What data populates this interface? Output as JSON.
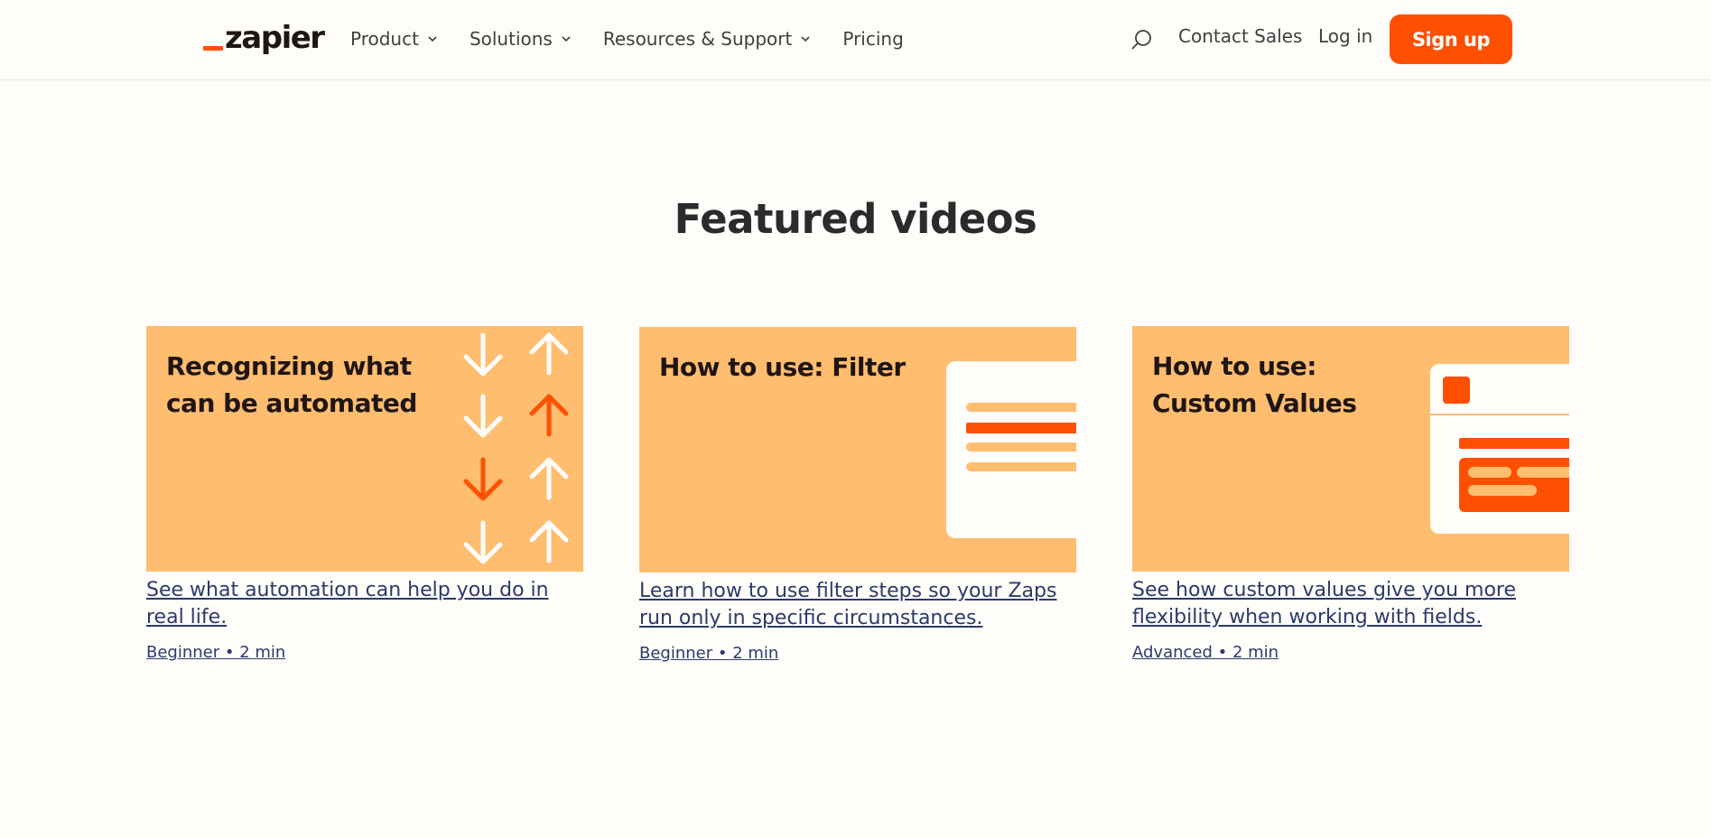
{
  "header": {
    "logo_text": "zapier",
    "nav": [
      {
        "label": "Product"
      },
      {
        "label": "Solutions"
      },
      {
        "label": "Resources & Support"
      },
      {
        "label": "Pricing"
      }
    ],
    "contact_sales": "Contact Sales",
    "log_in": "Log in",
    "sign_up": "Sign up"
  },
  "main": {
    "title": "Featured videos",
    "videos": [
      {
        "thumb_title": "Recognizing what can be automated",
        "description": "See what automation can help you do in real life.",
        "meta": "Beginner • 2 min"
      },
      {
        "thumb_title": "How to use: Filter",
        "description": "Learn how to use filter steps so your Zaps run only in specific circumstances.",
        "meta": "Beginner • 2 min"
      },
      {
        "thumb_title": "How to use: Custom Values",
        "description": "See how custom values give you more flexibility when working with fields.",
        "meta": "Advanced • 2 min"
      }
    ]
  },
  "colors": {
    "accent": "#ff4f00",
    "thumb_bg": "#ffbd6f",
    "page_bg": "#fffdf9",
    "link": "#2c3a6b"
  },
  "icons": [
    "search-icon",
    "chevron-down-icon",
    "arrow-down-icon",
    "arrow-up-icon"
  ]
}
